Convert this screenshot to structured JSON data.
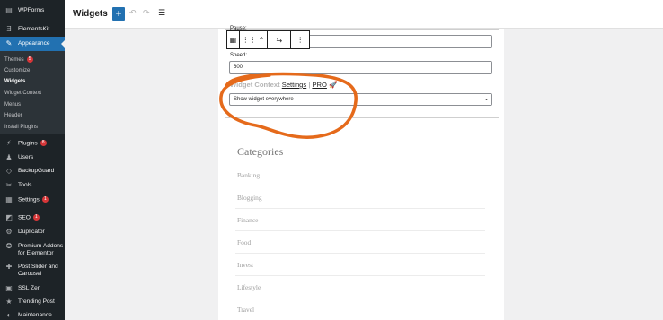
{
  "sidebar": {
    "items": [
      {
        "label": "WPForms",
        "icon": "form-icon",
        "badge": ""
      },
      {
        "label": "ElementsKit",
        "icon": "elementskit-icon",
        "badge": ""
      },
      {
        "label": "Appearance",
        "icon": "paintbrush-icon",
        "badge": ""
      },
      {
        "label": "Plugins",
        "icon": "plug-icon",
        "badge": "8"
      },
      {
        "label": "Users",
        "icon": "users-icon",
        "badge": ""
      },
      {
        "label": "BackupGuard",
        "icon": "shield-icon",
        "badge": ""
      },
      {
        "label": "Tools",
        "icon": "wrench-icon",
        "badge": ""
      },
      {
        "label": "Settings",
        "icon": "settings-icon",
        "badge": "1"
      },
      {
        "label": "SEO",
        "icon": "seo-icon",
        "badge": "1"
      },
      {
        "label": "Duplicator",
        "icon": "duplicator-icon",
        "badge": ""
      },
      {
        "label": "Premium Addons for Elementor",
        "icon": "addons-icon",
        "badge": ""
      },
      {
        "label": "Post Slider and Carousel",
        "icon": "pin-icon",
        "badge": ""
      },
      {
        "label": "SSL Zen",
        "icon": "ssl-icon",
        "badge": ""
      },
      {
        "label": "Trending Post",
        "icon": "star-icon",
        "badge": ""
      },
      {
        "label": "Maintenance",
        "icon": "maintenance-icon",
        "badge": ""
      }
    ],
    "submenu": [
      {
        "label": "Themes",
        "badge": "5"
      },
      {
        "label": "Customize",
        "badge": ""
      },
      {
        "label": "Widgets",
        "badge": ""
      },
      {
        "label": "Widget Context",
        "badge": ""
      },
      {
        "label": "Menus",
        "badge": ""
      },
      {
        "label": "Header",
        "badge": ""
      },
      {
        "label": "Install Plugins",
        "badge": ""
      }
    ]
  },
  "header": {
    "title": "Widgets",
    "add_label": "+"
  },
  "widget": {
    "pause_label": "Pause:",
    "speed_label": "Speed:",
    "speed_value": "600",
    "context_title": "Widget Context",
    "settings_link": "Settings",
    "separator": "|",
    "pro_link": "PRO",
    "visibility_value": "Show widget everywhere"
  },
  "categories": {
    "title": "Categories",
    "items": [
      "Banking",
      "Blogging",
      "Finance",
      "Food",
      "Invest",
      "Lifestyle",
      "Travel"
    ]
  },
  "colors": {
    "accent": "#2271b1",
    "annotation": "#e56a1b",
    "sidebar_bg": "#1d2327"
  }
}
